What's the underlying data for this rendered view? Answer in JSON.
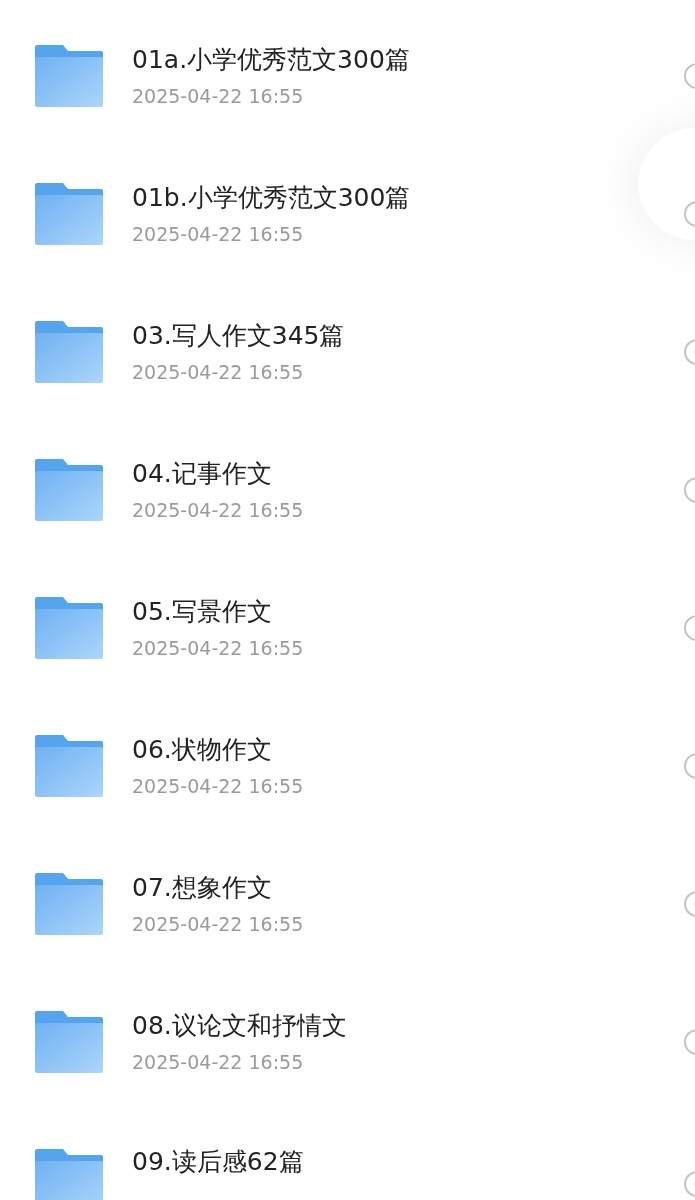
{
  "files": [
    {
      "name": "01a.小学优秀范文300篇",
      "date": "2025-04-22 16:55",
      "selected": false
    },
    {
      "name": "01b.小学优秀范文300篇",
      "date": "2025-04-22 16:55",
      "selected": false
    },
    {
      "name": "03.写人作文345篇",
      "date": "2025-04-22 16:55",
      "selected": false
    },
    {
      "name": "04.记事作文",
      "date": "2025-04-22 16:55",
      "selected": false
    },
    {
      "name": "05.写景作文",
      "date": "2025-04-22 16:55",
      "selected": false
    },
    {
      "name": "06.状物作文",
      "date": "2025-04-22 16:55",
      "selected": false
    },
    {
      "name": "07.想象作文",
      "date": "2025-04-22 16:55",
      "selected": false
    },
    {
      "name": "08.议论文和抒情文",
      "date": "2025-04-22 16:55",
      "selected": false
    },
    {
      "name": "09.读后感62篇",
      "selected": false
    }
  ]
}
